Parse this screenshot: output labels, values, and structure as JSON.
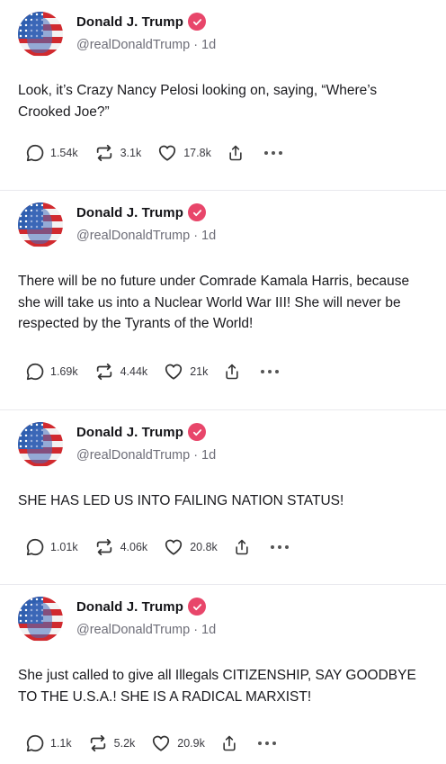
{
  "posts": [
    {
      "author": "Donald J. Trump",
      "handle": "@realDonaldTrump",
      "time": "1d",
      "text": "Look, it’s Crazy Nancy Pelosi looking on, saying, “Where’s Crooked Joe?”",
      "replies": "1.54k",
      "retruths": "3.1k",
      "likes": "17.8k"
    },
    {
      "author": "Donald J. Trump",
      "handle": "@realDonaldTrump",
      "time": "1d",
      "text": "There will be no future under Comrade Kamala Harris, because she will take us into a Nuclear World War III! She will never be respected by the Tyrants of the World!",
      "replies": "1.69k",
      "retruths": "4.44k",
      "likes": "21k"
    },
    {
      "author": "Donald J. Trump",
      "handle": "@realDonaldTrump",
      "time": "1d",
      "text": "SHE HAS LED US INTO FAILING NATION STATUS!",
      "replies": "1.01k",
      "retruths": "4.06k",
      "likes": "20.8k"
    },
    {
      "author": "Donald J. Trump",
      "handle": "@realDonaldTrump",
      "time": "1d",
      "text": "She just called to give all Illegals CITIZENSHIP, SAY GOODBYE TO THE U.S.A.! SHE IS A RADICAL MARXIST!",
      "replies": "1.1k",
      "retruths": "5.2k",
      "likes": "20.9k"
    }
  ],
  "colors": {
    "verified": "#e8466a",
    "text": "#1a1a1e",
    "muted": "#6e6e78",
    "divider": "#e9e9ee"
  },
  "icons": [
    "reply-icon",
    "retruth-icon",
    "heart-icon",
    "share-icon",
    "more-icon",
    "verified-icon"
  ]
}
